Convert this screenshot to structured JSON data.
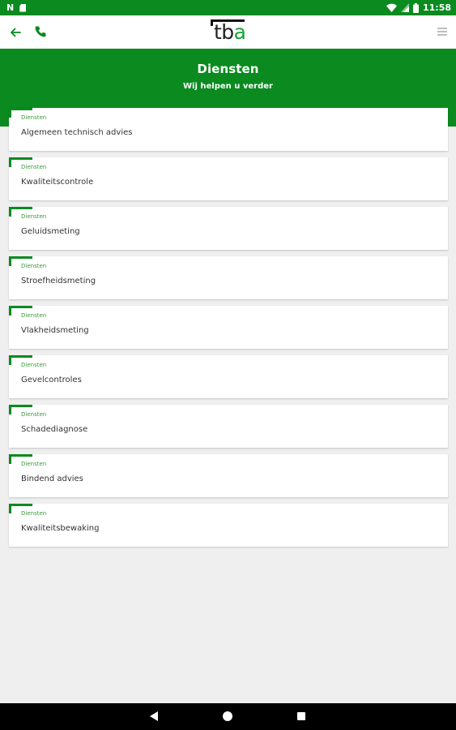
{
  "status_bar": {
    "time": "11:58",
    "left_icons": [
      "n-notification-icon",
      "sd-card-icon"
    ],
    "right_icons": [
      "wifi-icon",
      "signal-icon",
      "battery-icon"
    ],
    "n_label": "N"
  },
  "toolbar": {
    "logo_text_tb": "tb",
    "logo_text_a": "a",
    "icons": [
      "back-arrow-icon",
      "phone-icon",
      "menu-icon"
    ]
  },
  "header": {
    "title": "Diensten",
    "subtitle": "Wij helpen u verder"
  },
  "services": [
    {
      "category": "Diensten",
      "title": "Algemeen technisch advies"
    },
    {
      "category": "Diensten",
      "title": "Kwaliteitscontrole"
    },
    {
      "category": "Diensten",
      "title": "Geluidsmeting"
    },
    {
      "category": "Diensten",
      "title": "Stroefheidsmeting"
    },
    {
      "category": "Diensten",
      "title": "Vlakheidsmeting"
    },
    {
      "category": "Diensten",
      "title": "Gevelcontroles"
    },
    {
      "category": "Diensten",
      "title": "Schadediagnose"
    },
    {
      "category": "Diensten",
      "title": "Bindend advies"
    },
    {
      "category": "Diensten",
      "title": "Kwaliteitsbewaking"
    }
  ],
  "colors": {
    "brand_green": "#0a8a1f",
    "logo_accent": "#17a334",
    "background": "#efefef"
  },
  "nav_bar": {
    "icons": [
      "nav-back-icon",
      "nav-home-icon",
      "nav-recents-icon"
    ]
  }
}
